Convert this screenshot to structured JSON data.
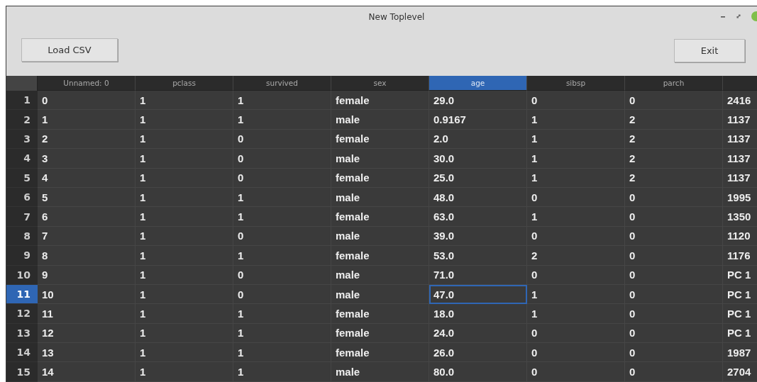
{
  "window": {
    "title": "New Toplevel"
  },
  "toolbar": {
    "buttons": [
      {
        "label": "Load CSV",
        "kind": "load"
      },
      {
        "label": "Exit",
        "kind": "exit"
      }
    ]
  },
  "table": {
    "columns": [
      {
        "label": "Unnamed: 0",
        "selected": false
      },
      {
        "label": "pclass",
        "selected": false
      },
      {
        "label": "survived",
        "selected": false
      },
      {
        "label": "sex",
        "selected": false
      },
      {
        "label": "age",
        "selected": true
      },
      {
        "label": "sibsp",
        "selected": false
      },
      {
        "label": "parch",
        "selected": false
      },
      {
        "selected": false
      }
    ],
    "rows": [
      {
        "header": "1",
        "selected": false,
        "cells": [
          {
            "text": "0",
            "focused": false
          },
          {
            "text": "1",
            "focused": false
          },
          {
            "text": "1",
            "focused": false
          },
          {
            "text": "female",
            "focused": false
          },
          {
            "text": "29.0",
            "focused": false
          },
          {
            "text": "0",
            "focused": false
          },
          {
            "text": "0",
            "focused": false
          },
          {
            "text": "2416",
            "focused": false
          }
        ]
      },
      {
        "header": "2",
        "selected": false,
        "cells": [
          {
            "text": "1",
            "focused": false
          },
          {
            "text": "1",
            "focused": false
          },
          {
            "text": "1",
            "focused": false
          },
          {
            "text": "male",
            "focused": false
          },
          {
            "text": "0.9167",
            "focused": false
          },
          {
            "text": "1",
            "focused": false
          },
          {
            "text": "2",
            "focused": false
          },
          {
            "text": "1137",
            "focused": false
          }
        ]
      },
      {
        "header": "3",
        "selected": false,
        "cells": [
          {
            "text": "2",
            "focused": false
          },
          {
            "text": "1",
            "focused": false
          },
          {
            "text": "0",
            "focused": false
          },
          {
            "text": "female",
            "focused": false
          },
          {
            "text": "2.0",
            "focused": false
          },
          {
            "text": "1",
            "focused": false
          },
          {
            "text": "2",
            "focused": false
          },
          {
            "text": "1137",
            "focused": false
          }
        ]
      },
      {
        "header": "4",
        "selected": false,
        "cells": [
          {
            "text": "3",
            "focused": false
          },
          {
            "text": "1",
            "focused": false
          },
          {
            "text": "0",
            "focused": false
          },
          {
            "text": "male",
            "focused": false
          },
          {
            "text": "30.0",
            "focused": false
          },
          {
            "text": "1",
            "focused": false
          },
          {
            "text": "2",
            "focused": false
          },
          {
            "text": "1137",
            "focused": false
          }
        ]
      },
      {
        "header": "5",
        "selected": false,
        "cells": [
          {
            "text": "4",
            "focused": false
          },
          {
            "text": "1",
            "focused": false
          },
          {
            "text": "0",
            "focused": false
          },
          {
            "text": "female",
            "focused": false
          },
          {
            "text": "25.0",
            "focused": false
          },
          {
            "text": "1",
            "focused": false
          },
          {
            "text": "2",
            "focused": false
          },
          {
            "text": "1137",
            "focused": false
          }
        ]
      },
      {
        "header": "6",
        "selected": false,
        "cells": [
          {
            "text": "5",
            "focused": false
          },
          {
            "text": "1",
            "focused": false
          },
          {
            "text": "1",
            "focused": false
          },
          {
            "text": "male",
            "focused": false
          },
          {
            "text": "48.0",
            "focused": false
          },
          {
            "text": "0",
            "focused": false
          },
          {
            "text": "0",
            "focused": false
          },
          {
            "text": "1995",
            "focused": false
          }
        ]
      },
      {
        "header": "7",
        "selected": false,
        "cells": [
          {
            "text": "6",
            "focused": false
          },
          {
            "text": "1",
            "focused": false
          },
          {
            "text": "1",
            "focused": false
          },
          {
            "text": "female",
            "focused": false
          },
          {
            "text": "63.0",
            "focused": false
          },
          {
            "text": "1",
            "focused": false
          },
          {
            "text": "0",
            "focused": false
          },
          {
            "text": "1350",
            "focused": false
          }
        ]
      },
      {
        "header": "8",
        "selected": false,
        "cells": [
          {
            "text": "7",
            "focused": false
          },
          {
            "text": "1",
            "focused": false
          },
          {
            "text": "0",
            "focused": false
          },
          {
            "text": "male",
            "focused": false
          },
          {
            "text": "39.0",
            "focused": false
          },
          {
            "text": "0",
            "focused": false
          },
          {
            "text": "0",
            "focused": false
          },
          {
            "text": "1120",
            "focused": false
          }
        ]
      },
      {
        "header": "9",
        "selected": false,
        "cells": [
          {
            "text": "8",
            "focused": false
          },
          {
            "text": "1",
            "focused": false
          },
          {
            "text": "1",
            "focused": false
          },
          {
            "text": "female",
            "focused": false
          },
          {
            "text": "53.0",
            "focused": false
          },
          {
            "text": "2",
            "focused": false
          },
          {
            "text": "0",
            "focused": false
          },
          {
            "text": "1176",
            "focused": false
          }
        ]
      },
      {
        "header": "10",
        "selected": false,
        "cells": [
          {
            "text": "9",
            "focused": false
          },
          {
            "text": "1",
            "focused": false
          },
          {
            "text": "0",
            "focused": false
          },
          {
            "text": "male",
            "focused": false
          },
          {
            "text": "71.0",
            "focused": false
          },
          {
            "text": "0",
            "focused": false
          },
          {
            "text": "0",
            "focused": false
          },
          {
            "text": "PC 1",
            "focused": false
          }
        ]
      },
      {
        "header": "11",
        "selected": true,
        "cells": [
          {
            "text": "10",
            "focused": false
          },
          {
            "text": "1",
            "focused": false
          },
          {
            "text": "0",
            "focused": false
          },
          {
            "text": "male",
            "focused": false
          },
          {
            "text": "47.0",
            "focused": true
          },
          {
            "text": "1",
            "focused": false
          },
          {
            "text": "0",
            "focused": false
          },
          {
            "text": "PC 1",
            "focused": false
          }
        ]
      },
      {
        "header": "12",
        "selected": false,
        "cells": [
          {
            "text": "11",
            "focused": false
          },
          {
            "text": "1",
            "focused": false
          },
          {
            "text": "1",
            "focused": false
          },
          {
            "text": "female",
            "focused": false
          },
          {
            "text": "18.0",
            "focused": false
          },
          {
            "text": "1",
            "focused": false
          },
          {
            "text": "0",
            "focused": false
          },
          {
            "text": "PC 1",
            "focused": false
          }
        ]
      },
      {
        "header": "13",
        "selected": false,
        "cells": [
          {
            "text": "12",
            "focused": false
          },
          {
            "text": "1",
            "focused": false
          },
          {
            "text": "1",
            "focused": false
          },
          {
            "text": "female",
            "focused": false
          },
          {
            "text": "24.0",
            "focused": false
          },
          {
            "text": "0",
            "focused": false
          },
          {
            "text": "0",
            "focused": false
          },
          {
            "text": "PC 1",
            "focused": false
          }
        ]
      },
      {
        "header": "14",
        "selected": false,
        "cells": [
          {
            "text": "13",
            "focused": false
          },
          {
            "text": "1",
            "focused": false
          },
          {
            "text": "1",
            "focused": false
          },
          {
            "text": "female",
            "focused": false
          },
          {
            "text": "26.0",
            "focused": false
          },
          {
            "text": "0",
            "focused": false
          },
          {
            "text": "0",
            "focused": false
          },
          {
            "text": "1987",
            "focused": false
          }
        ]
      },
      {
        "header": "15",
        "selected": false,
        "cells": [
          {
            "text": "14",
            "focused": false
          },
          {
            "text": "1",
            "focused": false
          },
          {
            "text": "1",
            "focused": false
          },
          {
            "text": "male",
            "focused": false
          },
          {
            "text": "80.0",
            "focused": false
          },
          {
            "text": "0",
            "focused": false
          },
          {
            "text": "0",
            "focused": false
          },
          {
            "text": "2704",
            "focused": false
          }
        ]
      }
    ]
  }
}
